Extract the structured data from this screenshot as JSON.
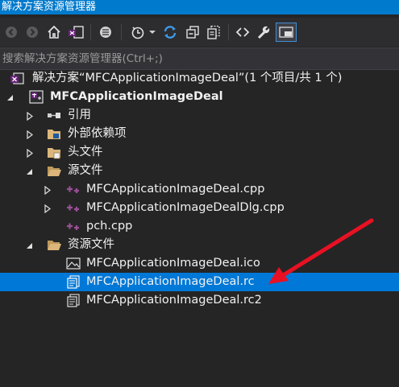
{
  "window": {
    "title": "解决方案资源管理器"
  },
  "toolbar": {
    "buttons": [
      {
        "name": "back-icon"
      },
      {
        "name": "forward-icon"
      },
      {
        "name": "home-icon"
      },
      {
        "name": "switch-views-icon"
      },
      {
        "name": "pending-changes-filter-icon"
      },
      {
        "name": "history-icon"
      },
      {
        "name": "dropdown-icon"
      },
      {
        "name": "refresh-icon"
      },
      {
        "name": "collapse-all-icon"
      },
      {
        "name": "show-all-files-icon"
      },
      {
        "name": "view-code-icon"
      },
      {
        "name": "properties-icon"
      },
      {
        "name": "preview-selected-icon"
      }
    ]
  },
  "search": {
    "placeholder": "搜索解决方案资源管理器(Ctrl+;)"
  },
  "tree": {
    "solution": "解决方案“MFCApplicationImageDeal”(1 个项目/共 1 个)",
    "project": "MFCApplicationImageDeal",
    "references": "引用",
    "external_deps": "外部依赖项",
    "header_files": "头文件",
    "source_files": "源文件",
    "source_items": [
      "MFCApplicationImageDeal.cpp",
      "MFCApplicationImageDealDlg.cpp",
      "pch.cpp"
    ],
    "resource_files": "资源文件",
    "resource_items": [
      "MFCApplicationImageDeal.ico",
      "MFCApplicationImageDeal.rc",
      "MFCApplicationImageDeal.rc2"
    ]
  },
  "selected_item": "MFCApplicationImageDeal.rc",
  "colors": {
    "accent": "#007acc",
    "selection": "#0078d7",
    "background": "#252526",
    "annotation_arrow": "#e81123"
  }
}
